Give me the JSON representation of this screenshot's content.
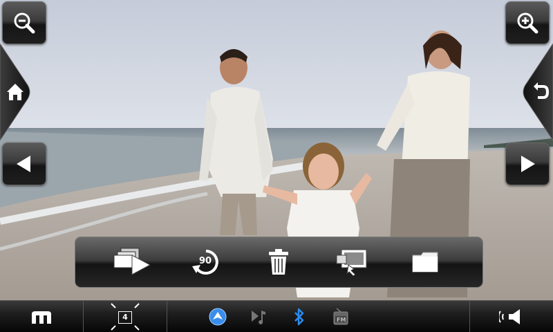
{
  "photo": {
    "subject": "family-beach-photo"
  },
  "toolbar": {
    "tools": [
      {
        "icon": "slideshow-icon"
      },
      {
        "icon": "rotate-icon",
        "label": "90"
      },
      {
        "icon": "trash-icon"
      },
      {
        "icon": "set-wallpaper-icon"
      },
      {
        "icon": "folder-icon"
      }
    ]
  },
  "status_bar": {
    "zoom_frame_value": "4",
    "colors": {
      "navigation_blue": "#3a8eea",
      "bluetooth_blue": "#2b8cf0"
    }
  }
}
